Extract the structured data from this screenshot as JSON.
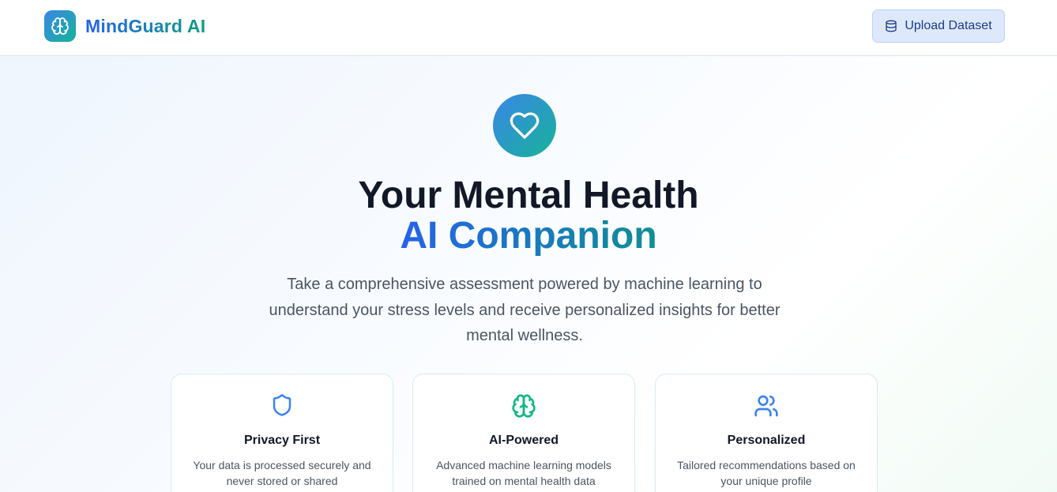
{
  "header": {
    "brand_name": "MindGuard AI",
    "brand_icon": "brain-icon",
    "upload_button_label": "Upload Dataset",
    "upload_button_icon": "database-icon"
  },
  "hero": {
    "icon": "heart-icon",
    "title_line1": "Your Mental Health",
    "title_line2": "AI Companion",
    "description": "Take a comprehensive assessment powered by machine learning to understand your stress levels and receive personalized insights for better mental wellness."
  },
  "features": [
    {
      "icon": "shield-icon",
      "title": "Privacy First",
      "description": "Your data is processed securely and never stored or shared"
    },
    {
      "icon": "brain-icon",
      "title": "AI-Powered",
      "description": "Advanced machine learning models trained on mental health data"
    },
    {
      "icon": "users-icon",
      "title": "Personalized",
      "description": "Tailored recommendations based on your unique profile"
    }
  ],
  "colors": {
    "brand_gradient_start": "#3a86e6",
    "brand_gradient_end": "#17b39a",
    "blue_accent": "#3b82f6",
    "green_accent": "#10b981"
  }
}
